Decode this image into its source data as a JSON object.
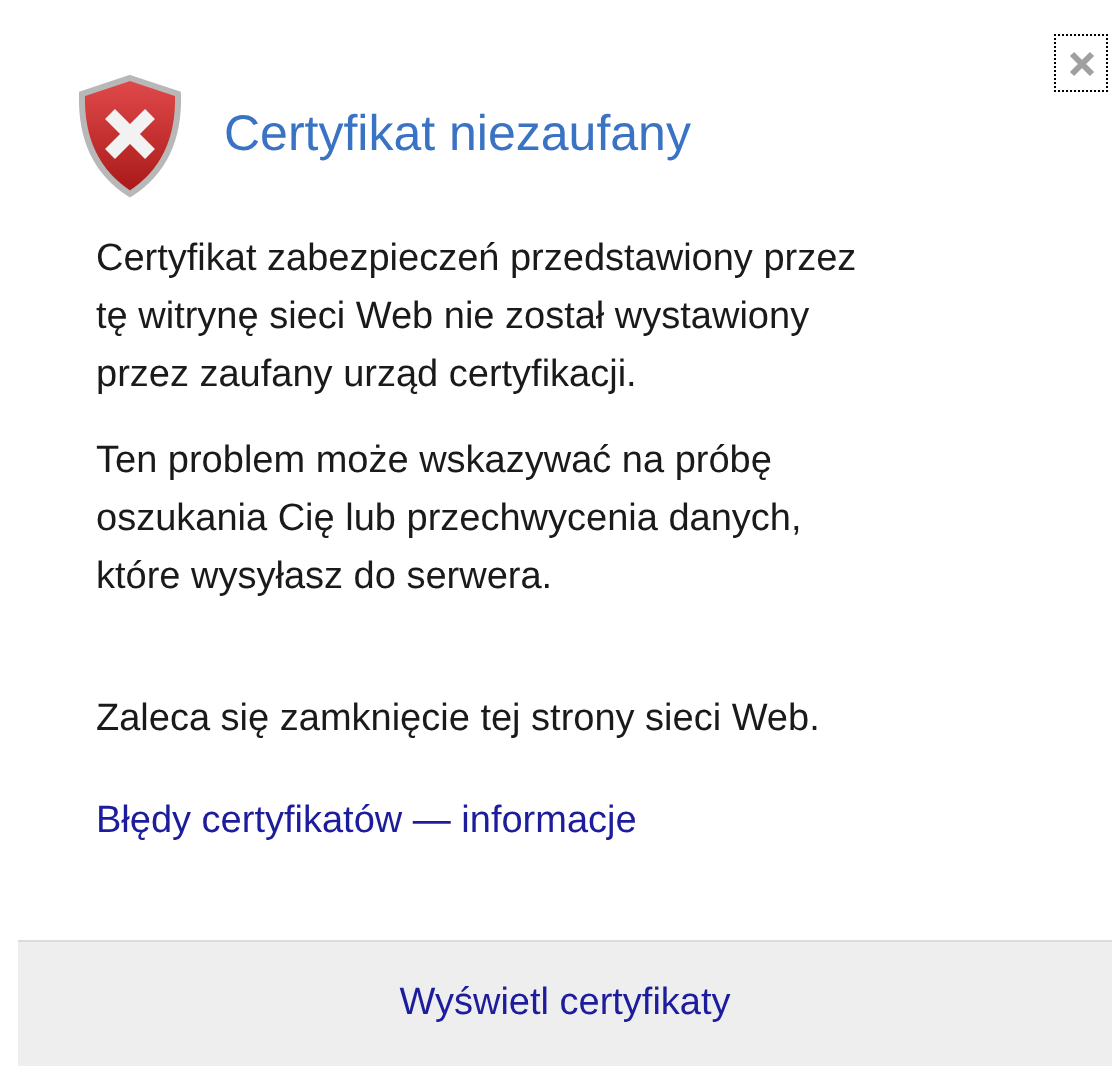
{
  "title": "Certyfikat niezaufany",
  "paragraphs": [
    "Certyfikat zabezpieczeń przedstawiony przez\ntę witrynę sieci Web nie został wystawiony\nprzez zaufany urząd certyfikacji.",
    "Ten problem może wskazywać na próbę\noszukania Cię lub przechwycenia danych,\nktóre wysyłasz do serwera.",
    "Zaleca się zamknięcie tej strony sieci Web."
  ],
  "link": "Błędy certyfikatów — informacje",
  "footer_button": "Wyświetl certyfikaty"
}
